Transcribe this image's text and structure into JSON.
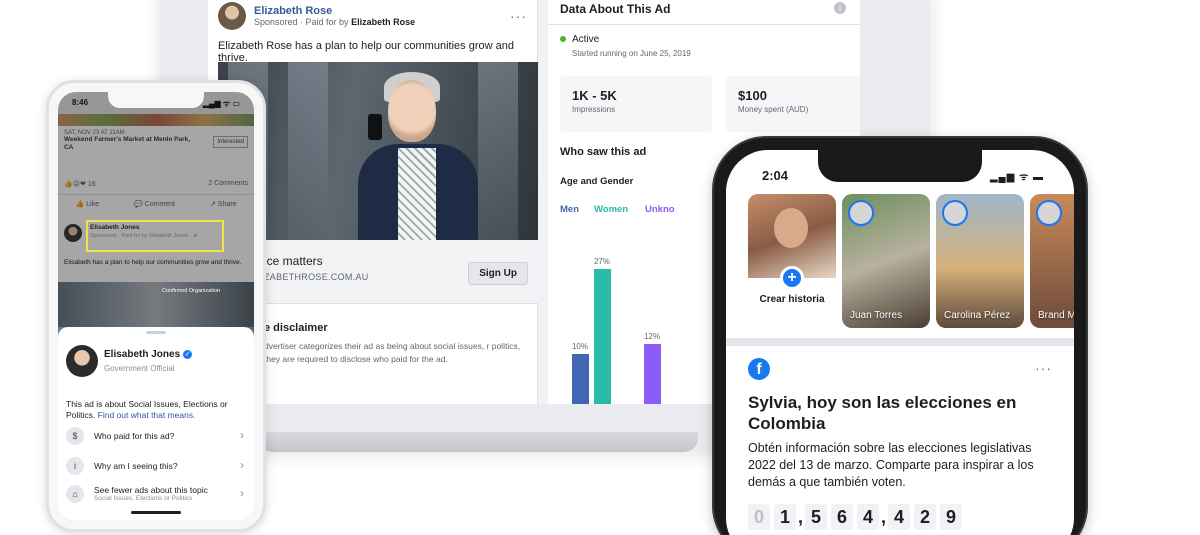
{
  "ad": {
    "page_name": "Elizabeth Rose",
    "sponsored_prefix": "Sponsored · Paid for by",
    "paid_for_by": "Elizabeth Rose",
    "more": "···",
    "text": "Elizabeth Rose has a plan to help our communities grow and thrive.",
    "link_title": "ice matters",
    "link_url": "ZABETHROSE.COM.AU",
    "cta": "Sign Up",
    "disclaimer_title": "e disclaimer",
    "disclaimer_text": "dvertiser categorizes their ad as being about social issues, r politics, they are required to disclose who paid for the ad."
  },
  "data_panel": {
    "title": "Data About This Ad",
    "info_icon": "i",
    "status": "Active",
    "started": "Started running on June 25, 2019",
    "impressions_value": "1K - 5K",
    "impressions_label": "Impressions",
    "spent_value": "$100",
    "spent_label": "Money spent (AUD)",
    "who_saw": "Who saw this ad",
    "age_gender": "Age and Gender",
    "legend": {
      "men": "Men",
      "women": "Women",
      "unknown": "Unkno"
    },
    "colors": {
      "men": "#4267b2",
      "women": "#2abba7",
      "unknown": "#8b5cf6"
    }
  },
  "chart_data": {
    "type": "bar",
    "categories": [
      "Men",
      "Women",
      "Unknown"
    ],
    "values": [
      10,
      27,
      12
    ],
    "value_labels": [
      "10%",
      "27%",
      "12%"
    ],
    "ylim": [
      0,
      30
    ]
  },
  "phone_left": {
    "time": "8:46",
    "status_icons": "▂▄▆ ᯤ ▭",
    "event_date": "SAT, NOV 23 AT 11AM",
    "event_title": "Weekend Farmer's Market at Menlo Park, CA",
    "interested": "Interested",
    "reactions": "16",
    "comments_count": "2 Comments",
    "like": "Like",
    "comment": "Comment",
    "share": "Share",
    "post_name": "Elisabeth Jones",
    "post_sub": "Sponsored · Paid for by Elisabeth Jones · ⊕",
    "post_text": "Elisabeth has a plan to help our communities grow and thrive.",
    "image_caption": "Confirmed Organization",
    "sheet": {
      "name": "Elisabeth Jones",
      "verified": "✓",
      "role": "Government Official",
      "about": "This ad is about Social Issues, Elections or Politics.",
      "about_link": "Find out what that means.",
      "rows": [
        {
          "icon": "$",
          "label": "Who paid for this ad?",
          "sub": ""
        },
        {
          "icon": "i",
          "label": "Why am I seeing this?",
          "sub": ""
        },
        {
          "icon": "⌂",
          "label": "See fewer ads about this topic",
          "sub": "Social Issues, Elections or Politics"
        }
      ]
    }
  },
  "phone_right": {
    "time": "2:04",
    "status_icons": "▂▄▆ ᯤ ▬",
    "stories": [
      {
        "name": "Crear historia"
      },
      {
        "name": "Juan Torres"
      },
      {
        "name": "Carolina Pérez"
      },
      {
        "name": "Brand Mora"
      }
    ],
    "create_plus": "+",
    "fb_icon": "f",
    "more": "···",
    "title": "Sylvia, hoy son las elecciones en Colombia",
    "body": "Obtén información sobre las elecciones legislativas 2022 del 13 de marzo. Comparte para inspirar a los demás a que también voten.",
    "counter_digits": [
      "0",
      "1",
      "5",
      "6",
      "4",
      "4",
      "2",
      "9"
    ],
    "counter_commas": ","
  }
}
